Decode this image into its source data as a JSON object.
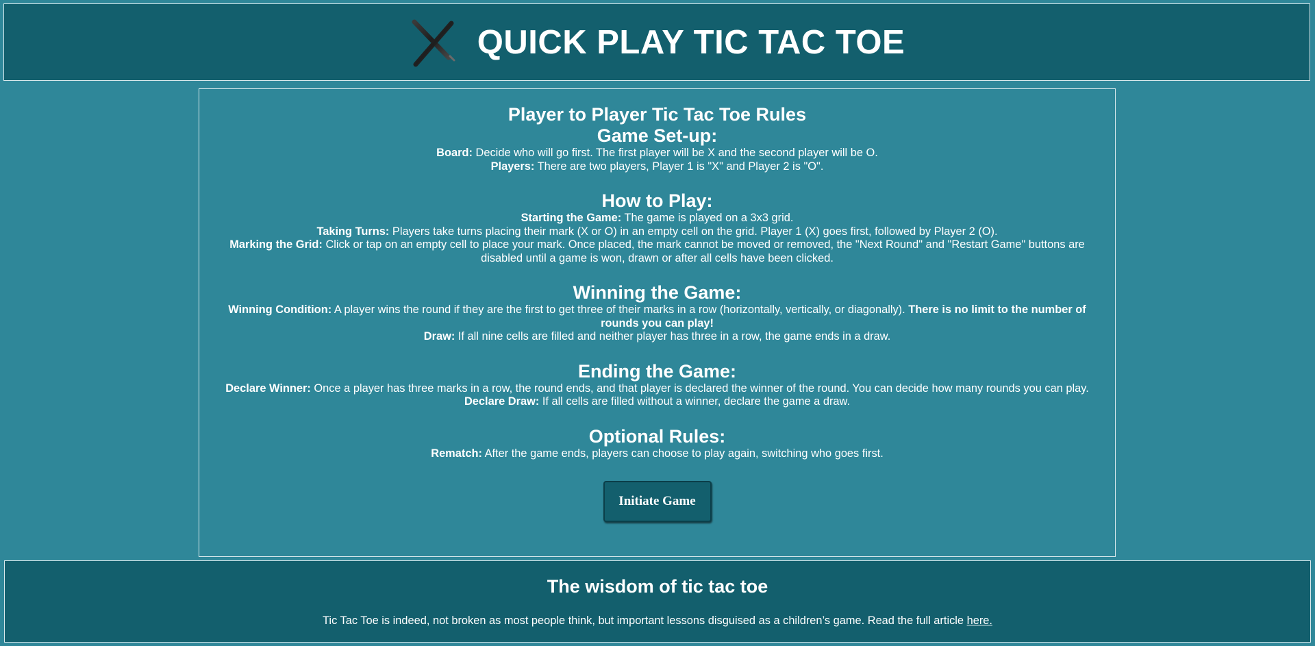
{
  "header": {
    "title": "QUICK PLAY TIC TAC TOE",
    "logo_icon": "x-mark-icon"
  },
  "rules": {
    "title": "Player to Player Tic Tac Toe Rules",
    "sections": [
      {
        "heading": "Game Set-up:",
        "items": [
          {
            "label": "Board:",
            "text": " Decide who will go first. The first player will be X and the second player will be O."
          },
          {
            "label": "Players:",
            "text": " There are two players, Player 1 is \"X\" and Player 2 is \"O\"."
          }
        ]
      },
      {
        "heading": "How to Play:",
        "items": [
          {
            "label": "Starting the Game:",
            "text": " The game is played on a 3x3 grid."
          },
          {
            "label": "Taking Turns:",
            "text": " Players take turns placing their mark (X or O) in an empty cell on the grid. Player 1 (X) goes first, followed by Player 2 (O)."
          },
          {
            "label": "Marking the Grid:",
            "text": " Click or tap on an empty cell to place your mark. Once placed, the mark cannot be moved or removed, the \"Next Round\" and \"Restart Game\" buttons are disabled until a game is won, drawn or after all cells have been clicked."
          }
        ]
      },
      {
        "heading": "Winning the Game:",
        "items": [
          {
            "label": "Winning Condition:",
            "text": " A player wins the round if they are the first to get three of their marks in a row (horizontally, vertically, or diagonally).",
            "emphasis": " There is no limit to the number of rounds you can play!"
          },
          {
            "label": "Draw:",
            "text": " If all nine cells are filled and neither player has three in a row, the game ends in a draw."
          }
        ]
      },
      {
        "heading": "Ending the Game:",
        "items": [
          {
            "label": "Declare Winner:",
            "text": " Once a player has three marks in a row, the round ends, and that player is declared the winner of the round. You can decide how many rounds you can play."
          },
          {
            "label": "Declare Draw:",
            "text": " If all cells are filled without a winner, declare the game a draw."
          }
        ]
      },
      {
        "heading": "Optional Rules:",
        "items": [
          {
            "label": "Rematch:",
            "text": " After the game ends, players can choose to play again, switching who goes first."
          }
        ]
      }
    ],
    "button_label": "Initiate Game"
  },
  "footer": {
    "heading": "The wisdom of tic tac toe",
    "text": "Tic Tac Toe is indeed, not broken as most people think, but important lessons disguised as a children’s game. Read the full article ",
    "link_text": "here."
  },
  "colors": {
    "background": "#2f8799",
    "panel": "#135f6d",
    "border": "#d9e9ec",
    "text": "#ffffff"
  }
}
